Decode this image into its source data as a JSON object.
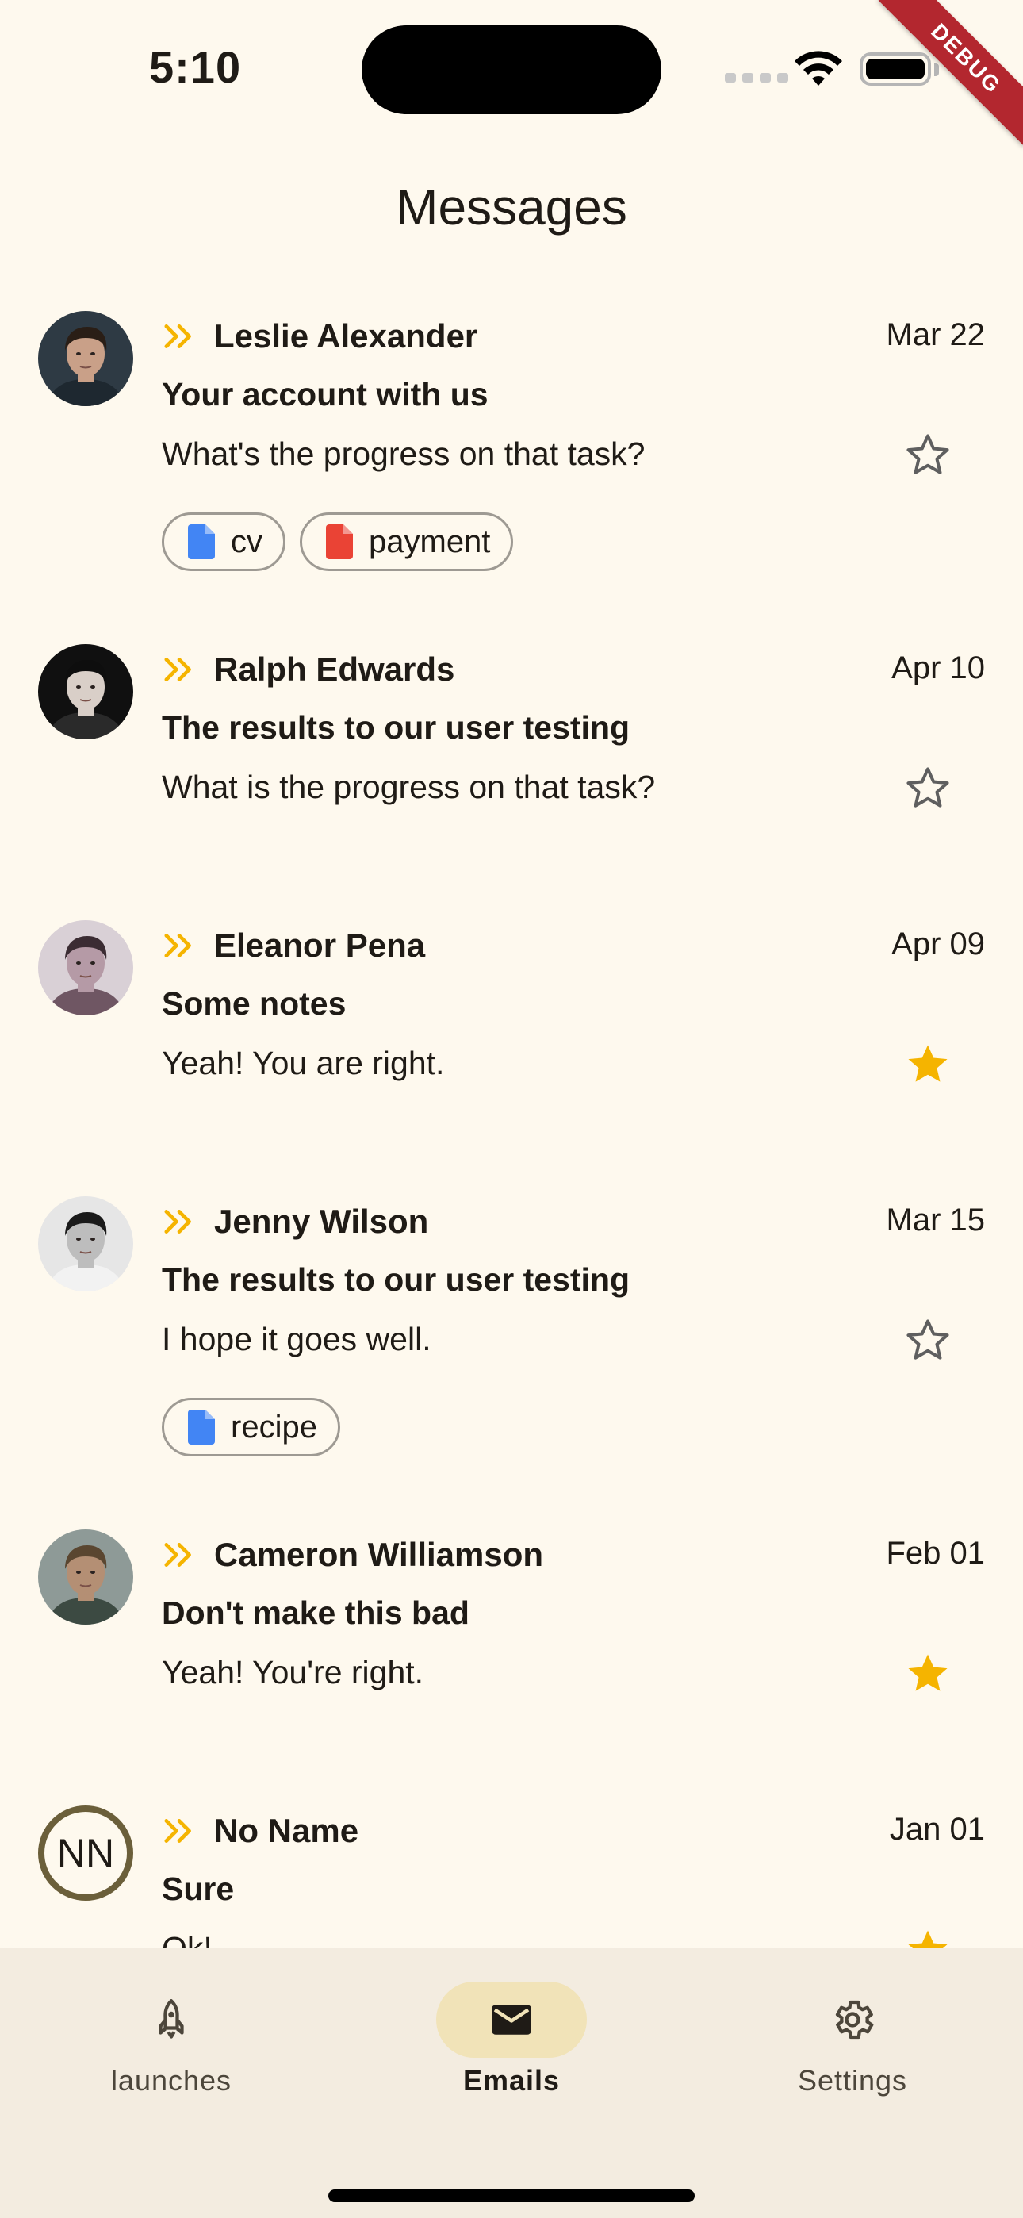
{
  "status_bar": {
    "time": "5:10",
    "debug_label": "DEBUG"
  },
  "header": {
    "title": "Messages"
  },
  "messages": [
    {
      "sender": "Leslie Alexander",
      "date": "Mar 22",
      "subject": "Your account with us",
      "preview": "What's the progress on that task?",
      "starred": false,
      "attachments": [
        {
          "name": "cv",
          "color": "#4285F4"
        },
        {
          "name": "payment",
          "color": "#EA4335"
        }
      ]
    },
    {
      "sender": "Ralph Edwards",
      "date": "Apr 10",
      "subject": "The results to our user testing",
      "preview": "What is the progress on that task?",
      "starred": false,
      "attachments": []
    },
    {
      "sender": "Eleanor Pena",
      "date": "Apr 09",
      "subject": "Some notes",
      "preview": "Yeah! You are right.",
      "starred": true,
      "attachments": []
    },
    {
      "sender": "Jenny Wilson",
      "date": "Mar 15",
      "subject": "The results to our user testing",
      "preview": "I hope it goes well.",
      "starred": false,
      "attachments": [
        {
          "name": "recipe",
          "color": "#4285F4"
        }
      ]
    },
    {
      "sender": "Cameron Williamson",
      "date": "Feb 01",
      "subject": "Don't make this bad",
      "preview": "Yeah! You're right.",
      "starred": true,
      "attachments": []
    },
    {
      "sender": "No Name",
      "initials": "NN",
      "date": "Jan 01",
      "subject": "Sure",
      "preview": "Ok!",
      "starred": true,
      "attachments": []
    }
  ],
  "bottom_nav": {
    "items": [
      {
        "label": "launches",
        "icon": "rocket-icon",
        "active": false
      },
      {
        "label": "Emails",
        "icon": "mail-icon",
        "active": true
      },
      {
        "label": "Settings",
        "icon": "gear-icon",
        "active": false
      }
    ]
  },
  "colors": {
    "background": "#FEF9EE",
    "accent": "#F5B400",
    "nav_background": "#F3ECE0",
    "nav_active_pill": "#F1E3B8"
  }
}
